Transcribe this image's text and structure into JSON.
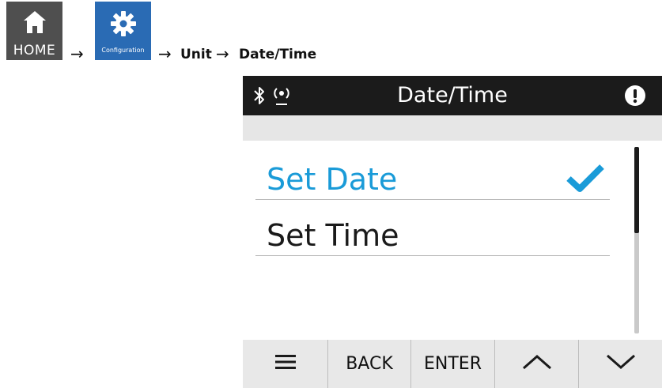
{
  "breadcrumb": {
    "home_label": "HOME",
    "config_label": "Configuration",
    "arrow": "→",
    "level_unit": "Unit",
    "level_datetime": "Date/Time"
  },
  "device": {
    "title": "Date/Time",
    "status_icons": [
      "bluetooth-icon",
      "signal-icon",
      "alert-icon"
    ],
    "menu_items": [
      {
        "label": "Set Date",
        "selected": true
      },
      {
        "label": "Set Time",
        "selected": false
      }
    ],
    "scroll_fraction_visible": 0.46,
    "softkeys": [
      {
        "name": "menu",
        "icon": "hamburger-icon"
      },
      {
        "name": "back",
        "label": "BACK"
      },
      {
        "name": "enter",
        "label": "ENTER"
      },
      {
        "name": "up",
        "icon": "chevron-up-icon"
      },
      {
        "name": "down",
        "icon": "chevron-down-icon"
      }
    ]
  },
  "colors": {
    "title_bar": "#1b1b1b",
    "selected_text": "#1a9bd8",
    "home_tile": "#4f4f4f",
    "config_tile": "#2a6bb4",
    "softkey_bar": "#e8e8e8"
  }
}
